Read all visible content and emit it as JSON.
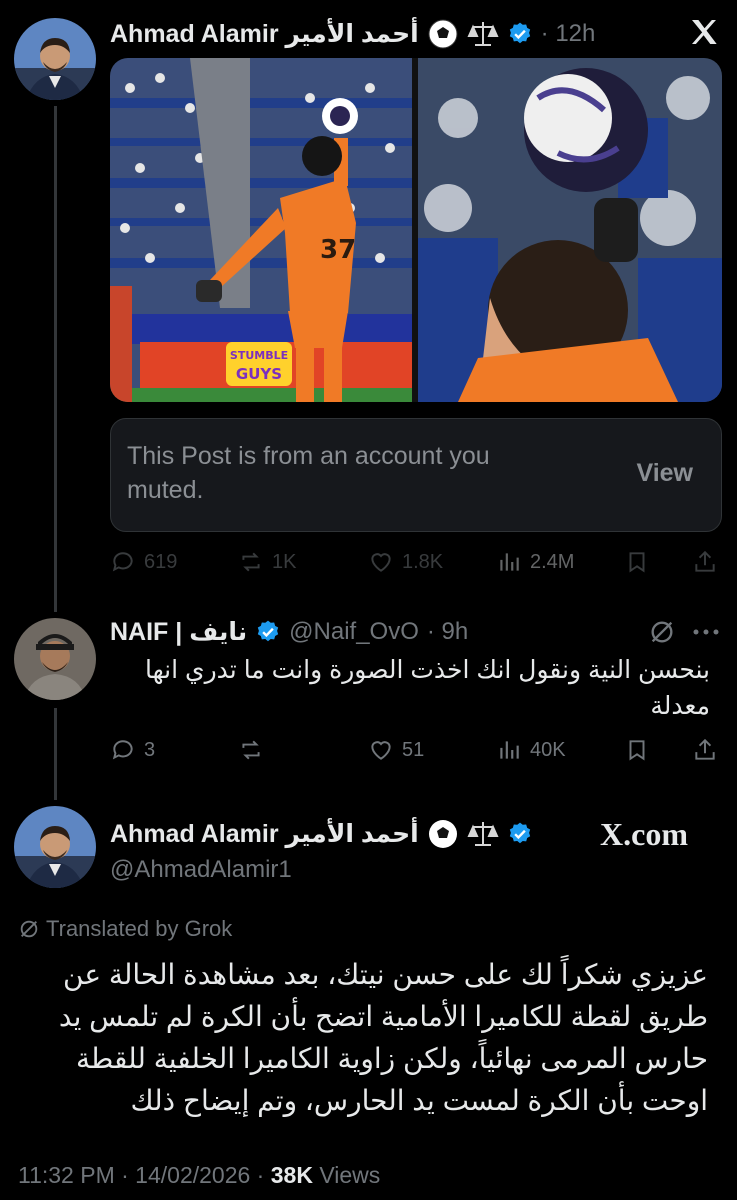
{
  "tweet1": {
    "name": "Ahmad Alamir أحمد الأمير",
    "time": "· 12h",
    "muted_text": "This Post is from an account you muted.",
    "view_label": "View",
    "stats": {
      "replies": "619",
      "reposts": "1K",
      "likes": "1.8K",
      "views": "2.4M"
    }
  },
  "tweet2": {
    "name": "NAIF | نايف",
    "handle": "@Naif_OvO",
    "time": "· 9h",
    "text": "بنحسن النية ونقول انك اخذت الصورة وانت ما تدري انها معدلة",
    "stats": {
      "replies": "3",
      "reposts": "",
      "likes": "51",
      "views": "40K"
    }
  },
  "tweet3": {
    "name": "Ahmad Alamir أحمد الأمير",
    "handle": "@AhmadAlamir1",
    "watermark": "X.com",
    "translated_label": "Translated by Grok",
    "text": "عزيزي شكراً لك على حسن نيتك، بعد مشاهدة الحالة عن طريق لقطة للكاميرا الأمامية اتضح بأن الكرة لم تلمس يد حارس المرمى نهائياً، ولكن زاوية الكاميرا الخلفية للقطة اوحت بأن الكرة لمست يد الحارس، وتم إيضاح ذلك",
    "footer_time": "11:32 PM · 14/02/2026 · ",
    "footer_views_count": "38K",
    "footer_views_label": " Views"
  },
  "media_left": {
    "sponsor_line1": "STUMBLE",
    "sponsor_line2": "GUYS",
    "jersey_number": "37"
  },
  "colors": {
    "background": "#000000",
    "verified_blue": "#1d9bf0",
    "keeper_orange": "#f07a26",
    "muted_gray": "#71767b"
  }
}
